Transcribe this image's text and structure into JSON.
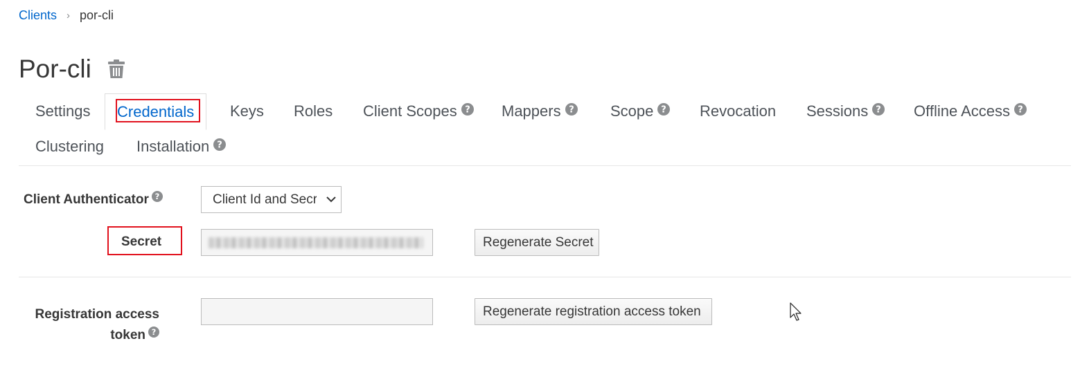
{
  "breadcrumb": {
    "parent": "Clients",
    "separator": "›",
    "current": "por-cli"
  },
  "page": {
    "title": "Por-cli"
  },
  "tabs": [
    {
      "label": "Settings",
      "help": false
    },
    {
      "label": "Credentials",
      "help": false,
      "active": true
    },
    {
      "label": "Keys",
      "help": false
    },
    {
      "label": "Roles",
      "help": false
    },
    {
      "label": "Client Scopes",
      "help": true
    },
    {
      "label": "Mappers",
      "help": true
    },
    {
      "label": "Scope",
      "help": true
    },
    {
      "label": "Revocation",
      "help": false
    },
    {
      "label": "Sessions",
      "help": true
    },
    {
      "label": "Offline Access",
      "help": true
    },
    {
      "label": "Clustering",
      "help": false
    },
    {
      "label": "Installation",
      "help": true
    }
  ],
  "form": {
    "client_authenticator": {
      "label": "Client Authenticator",
      "selected": "Client Id and Secret"
    },
    "secret": {
      "label": "Secret",
      "button": "Regenerate Secret"
    },
    "registration": {
      "label_line1": "Registration access",
      "label_line2": "token",
      "value": "",
      "button": "Regenerate registration access token"
    }
  },
  "colors": {
    "link": "#0066cc",
    "highlight": "#e1101c",
    "help_icon": "#8b8d8f"
  }
}
